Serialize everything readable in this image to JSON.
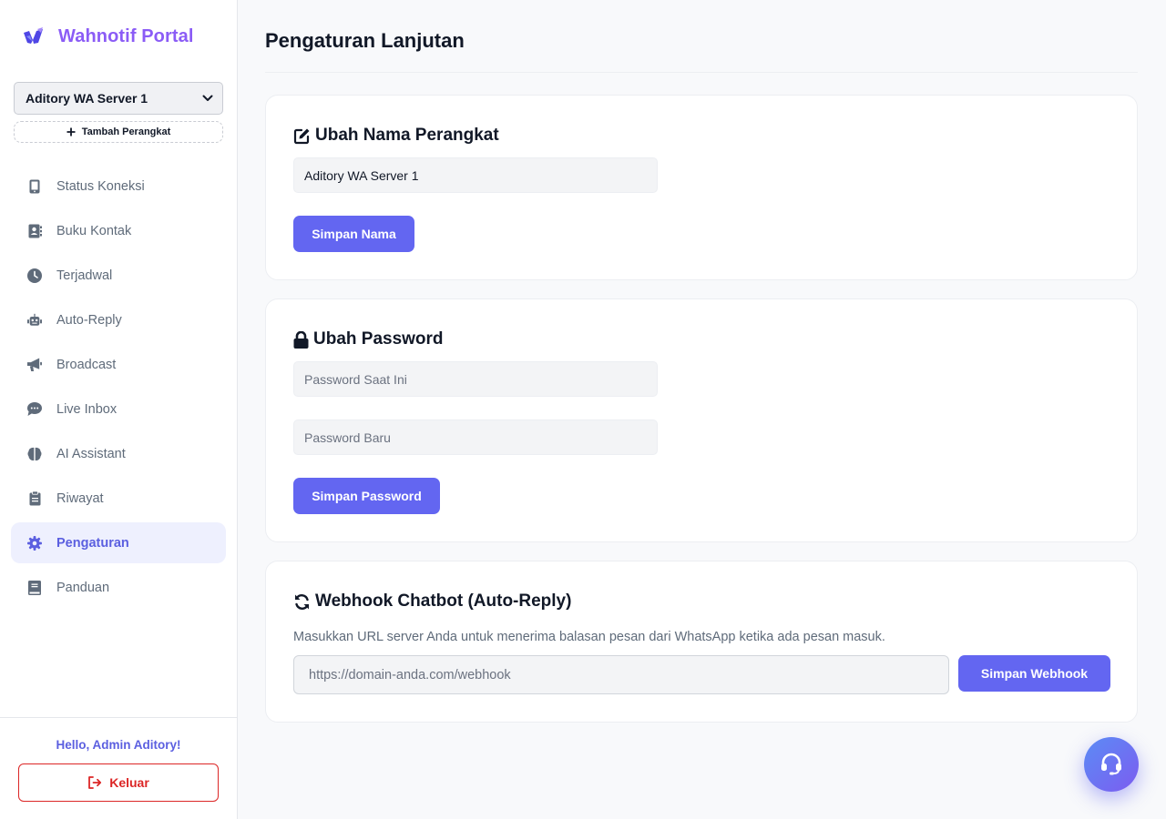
{
  "brand": {
    "title": "Wahnotif Portal",
    "logo_icon": "wing-logo-icon",
    "color": "#8b5cf6"
  },
  "device": {
    "selected": "Aditory WA Server 1",
    "add_label": "Tambah Perangkat"
  },
  "nav": {
    "items": [
      {
        "label": "Status Koneksi",
        "icon": "mobile-icon"
      },
      {
        "label": "Buku Kontak",
        "icon": "address-book-icon"
      },
      {
        "label": "Terjadwal",
        "icon": "clock-icon"
      },
      {
        "label": "Auto-Reply",
        "icon": "robot-icon"
      },
      {
        "label": "Broadcast",
        "icon": "megaphone-icon"
      },
      {
        "label": "Live Inbox",
        "icon": "chat-icon"
      },
      {
        "label": "AI Assistant",
        "icon": "brain-icon"
      },
      {
        "label": "Riwayat",
        "icon": "clipboard-icon"
      },
      {
        "label": "Pengaturan",
        "icon": "gear-icon",
        "active": true
      },
      {
        "label": "Panduan",
        "icon": "book-icon"
      }
    ]
  },
  "footer": {
    "hello": "Hello, Admin Aditory!",
    "logout_label": "Keluar"
  },
  "page": {
    "title": "Pengaturan Lanjutan"
  },
  "rename": {
    "title": "Ubah Nama Perangkat",
    "value": "Aditory WA Server 1",
    "button": "Simpan Nama"
  },
  "password": {
    "title": "Ubah Password",
    "current_placeholder": "Password Saat Ini",
    "new_placeholder": "Password Baru",
    "button": "Simpan Password"
  },
  "webhook": {
    "title": "Webhook Chatbot (Auto-Reply)",
    "description": "Masukkan URL server Anda untuk menerima balasan pesan dari WhatsApp ketika ada pesan masuk.",
    "placeholder": "https://domain-anda.com/webhook",
    "button": "Simpan Webhook"
  },
  "colors": {
    "accent": "#6366f1",
    "danger": "#dc2626",
    "active_bg": "#eef0fe"
  },
  "support": {
    "icon": "headset-icon"
  }
}
